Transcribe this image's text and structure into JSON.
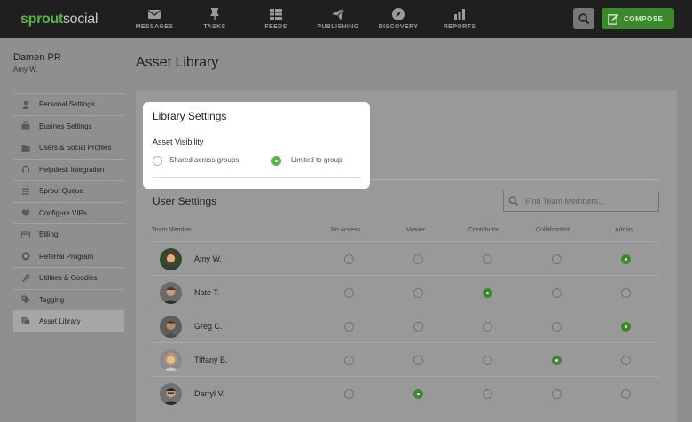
{
  "brand": {
    "logo_part1": "sprout",
    "logo_part2": "social",
    "accent": "#59b548"
  },
  "nav": [
    {
      "label": "MESSAGES",
      "icon": "envelope-icon"
    },
    {
      "label": "TASKS",
      "icon": "pin-icon"
    },
    {
      "label": "FEEDS",
      "icon": "feeds-icon"
    },
    {
      "label": "PUBLISHING",
      "icon": "paper-plane-icon"
    },
    {
      "label": "DISCOVERY",
      "icon": "compass-icon"
    },
    {
      "label": "REPORTS",
      "icon": "bar-chart-icon"
    }
  ],
  "compose": {
    "label": "COMPOSE"
  },
  "profile": {
    "name": "Damen PR",
    "sub": "Amy W."
  },
  "sidebar": {
    "items": [
      {
        "label": "Personal Settings",
        "icon": "person-icon"
      },
      {
        "label": "Busines Settings",
        "icon": "briefcase-icon"
      },
      {
        "label": "Users & Social Profiles",
        "icon": "folder-icon"
      },
      {
        "label": "Helpdesk Integration",
        "icon": "headset-icon"
      },
      {
        "label": "Sprout Queue",
        "icon": "queue-icon"
      },
      {
        "label": "Configure VIPs",
        "icon": "heart-icon"
      },
      {
        "label": "Billing",
        "icon": "card-icon"
      },
      {
        "label": "Referral Program",
        "icon": "star-icon"
      },
      {
        "label": "Utilities & Goodies",
        "icon": "wrench-icon"
      },
      {
        "label": "Tagging",
        "icon": "tag-icon"
      },
      {
        "label": "Asset Library",
        "icon": "library-icon"
      }
    ],
    "active_index": 10
  },
  "page": {
    "title": "Asset Library"
  },
  "library_settings": {
    "title": "Library Settings",
    "visibility_label": "Asset Visibility",
    "options": [
      "Shared across groups",
      "Limited to group"
    ],
    "selected": "Limited to group"
  },
  "user_settings": {
    "title": "User Settings",
    "search_placeholder": "Find Team Members...",
    "columns": [
      "Team Member",
      "No Access",
      "Viewer",
      "Contributor",
      "Collaborator",
      "Admin"
    ],
    "rows": [
      {
        "name": "Amy W.",
        "role": "Admin"
      },
      {
        "name": "Nate T.",
        "role": "Contributor"
      },
      {
        "name": "Greg C.",
        "role": "Admin"
      },
      {
        "name": "Tiffany B.",
        "role": "Collaborator"
      },
      {
        "name": "Darryl V.",
        "role": "Viewer"
      }
    ]
  }
}
